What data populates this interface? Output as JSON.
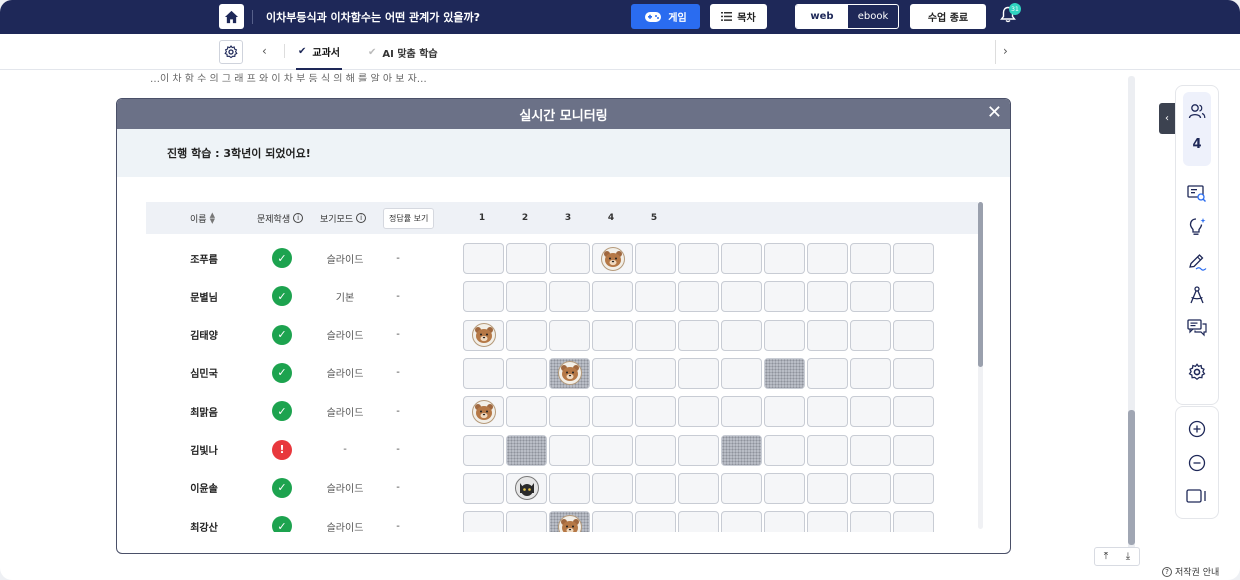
{
  "header": {
    "title": "이차부등식과 이차함수는 어떤 관계가 있을까?",
    "game_label": "게임",
    "toc_label": "목차",
    "view_web": "web",
    "view_ebook": "ebook",
    "end_class_label": "수업 종료",
    "notification_count": "31"
  },
  "subnav": {
    "tabs": [
      {
        "label": "교과서",
        "active": true
      },
      {
        "label": "AI 맞춤 학습",
        "active": false
      }
    ]
  },
  "background_text": "…이 차 함 수 의 그 래 프 와 이 차 부 등 식 의 해 를 알 아 보 자…",
  "right_panel": {
    "user_count": "4"
  },
  "footer": {
    "copyright_label": "저작권 안내"
  },
  "modal": {
    "title": "실시간 모니터링",
    "current_lesson": "진행 학습 : 3학년이 되었어요!",
    "columns": {
      "name": "이름",
      "problem_student": "문제학생",
      "view_mode": "보기모드",
      "show_answer_button": "정답률 보기",
      "questions": [
        "1",
        "2",
        "3",
        "4",
        "5"
      ]
    },
    "students": [
      {
        "name": "조푸름",
        "status": "ok",
        "mode": "슬라이드",
        "answer": "-",
        "cells": [
          "",
          "",
          "",
          "bear",
          "",
          "",
          "",
          "",
          "",
          "",
          ""
        ]
      },
      {
        "name": "문별님",
        "status": "ok",
        "mode": "기본",
        "answer": "-",
        "cells": [
          "",
          "",
          "",
          "",
          "",
          "",
          "",
          "",
          "",
          "",
          ""
        ]
      },
      {
        "name": "김태양",
        "status": "ok",
        "mode": "슬라이드",
        "answer": "-",
        "cells": [
          "bear",
          "",
          "",
          "",
          "",
          "",
          "",
          "",
          "",
          "",
          ""
        ]
      },
      {
        "name": "심민국",
        "status": "ok",
        "mode": "슬라이드",
        "answer": "-",
        "cells": [
          "",
          "",
          "bear-dot",
          "",
          "",
          "",
          "",
          "dot",
          "",
          "",
          ""
        ]
      },
      {
        "name": "최맑음",
        "status": "ok",
        "mode": "슬라이드",
        "answer": "-",
        "cells": [
          "bear",
          "",
          "",
          "",
          "",
          "",
          "",
          "",
          "",
          "",
          ""
        ]
      },
      {
        "name": "김빛나",
        "status": "bad",
        "mode": "-",
        "answer": "-",
        "cells": [
          "",
          "dot",
          "",
          "",
          "",
          "",
          "dot",
          "",
          "",
          "",
          ""
        ]
      },
      {
        "name": "이윤솔",
        "status": "ok",
        "mode": "슬라이드",
        "answer": "-",
        "cells": [
          "",
          "cat",
          "",
          "",
          "",
          "",
          "",
          "",
          "",
          "",
          ""
        ]
      },
      {
        "name": "최강산",
        "status": "ok",
        "mode": "슬라이드",
        "answer": "-",
        "cells": [
          "",
          "",
          "bear-dot",
          "",
          "",
          "",
          "",
          "",
          "",
          "",
          ""
        ]
      }
    ]
  }
}
